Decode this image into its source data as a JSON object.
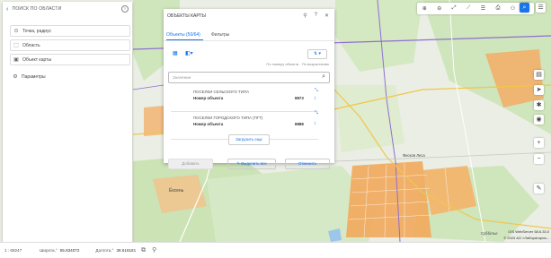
{
  "left_panel": {
    "header": "ПОИСК ПО ОБЛАСТИ",
    "buttons": [
      "Точка, радиус",
      "Область",
      "Объект карты"
    ],
    "params": "Параметры"
  },
  "dialog": {
    "title": "ОБЪЕКТЫ КАРТЫ",
    "tabs": [
      "Объекты (50/64)",
      "Фильтры"
    ],
    "hint": "По номеру объекта · По возрастанию",
    "search_placeholder": "Значение",
    "results": [
      {
        "category": "ПОСЕЛКИ СЕЛЬСКОГО ТИПА",
        "label": "Номер объекта",
        "number": "8873"
      },
      {
        "category": "ПОСЕЛКИ ГОРОДСКОГО ТИПА (ПГТ)",
        "label": "Номер объекта",
        "number": "8888"
      }
    ],
    "load_more": "Загрузить еще",
    "btn_add": "Добавить",
    "btn_select_all": "Выделить все",
    "btn_cancel": "Отменить"
  },
  "status": {
    "scale": "1 : 68247",
    "lat_label": "Широта,°",
    "lat": "55.834072",
    "lon_label": "Долгота,°",
    "lon": "38.616181"
  },
  "map": {
    "labels": [
      "Фисков Леса",
      "Субботье",
      "Ёксень"
    ],
    "copyright1": "OIS WebServer 58.6.33.0",
    "copyright2": "© 2024 АО «Лаборатория...",
    "colors": {
      "road": "#8e6fd0",
      "builtup": "#f3a65a",
      "forest": "#c9e3b4"
    }
  }
}
